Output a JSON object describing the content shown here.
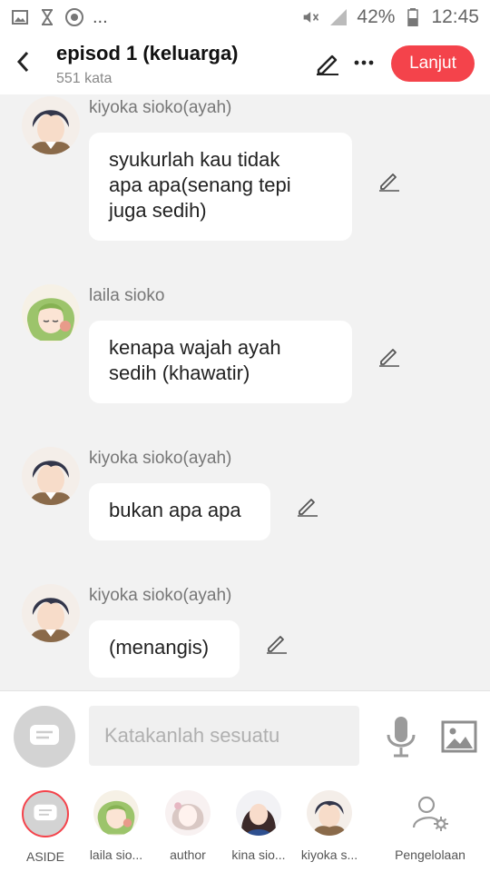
{
  "status_bar": {
    "overflow": "...",
    "battery": "42%",
    "time": "12:45",
    "left_icons": [
      "image-icon",
      "hourglass-icon",
      "chrome-icon"
    ],
    "right_icons": [
      "mute-icon",
      "signal-icon",
      "battery-icon"
    ]
  },
  "header": {
    "title": "episod 1 (keluarga)",
    "word_count": "551 kata",
    "next_label": "Lanjut",
    "accent_color": "#f4434b"
  },
  "messages": [
    {
      "sender": "kiyoka sioko(ayah)",
      "text": "syukurlah kau tidak\napa apa(senang tepi\njuga sedih)"
    },
    {
      "sender": "laila sioko",
      "text": "kenapa wajah ayah\nsedih (khawatir)"
    },
    {
      "sender": "kiyoka sioko(ayah)",
      "text": "bukan apa apa"
    },
    {
      "sender": "kiyoka sioko(ayah)",
      "text": "(menangis)"
    }
  ],
  "composer": {
    "placeholder": "Katakanlah sesuatu"
  },
  "characters": [
    {
      "label": "ASIDE"
    },
    {
      "label": "laila sio..."
    },
    {
      "label": "author"
    },
    {
      "label": "kina sio..."
    },
    {
      "label": "kiyoka s..."
    },
    {
      "label": "Pengelolaan"
    }
  ]
}
